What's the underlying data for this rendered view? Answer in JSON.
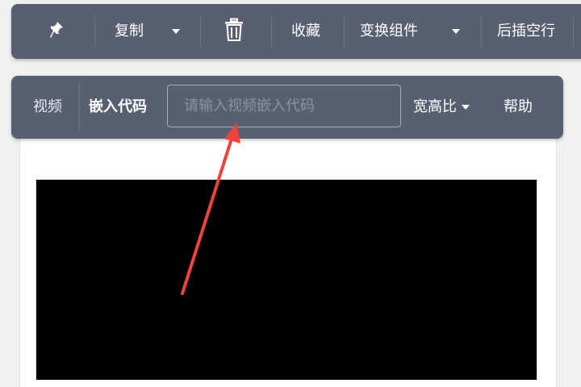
{
  "top_toolbar": {
    "pin_icon": "pin-icon",
    "copy_label": "复制",
    "delete_icon": "trash-icon",
    "favorite_label": "收藏",
    "transform_label": "变换组件",
    "insert_empty_line_label": "后插空行"
  },
  "video_toolbar": {
    "video_label": "视频",
    "embed_code_label": "嵌入代码",
    "embed_placeholder": "请输入视频嵌入代码",
    "aspect_ratio_label": "宽高比",
    "help_label": "帮助"
  },
  "colors": {
    "toolbar_bg": "#575f70",
    "video_bg": "#000000",
    "annotation_arrow": "#f0413c"
  }
}
